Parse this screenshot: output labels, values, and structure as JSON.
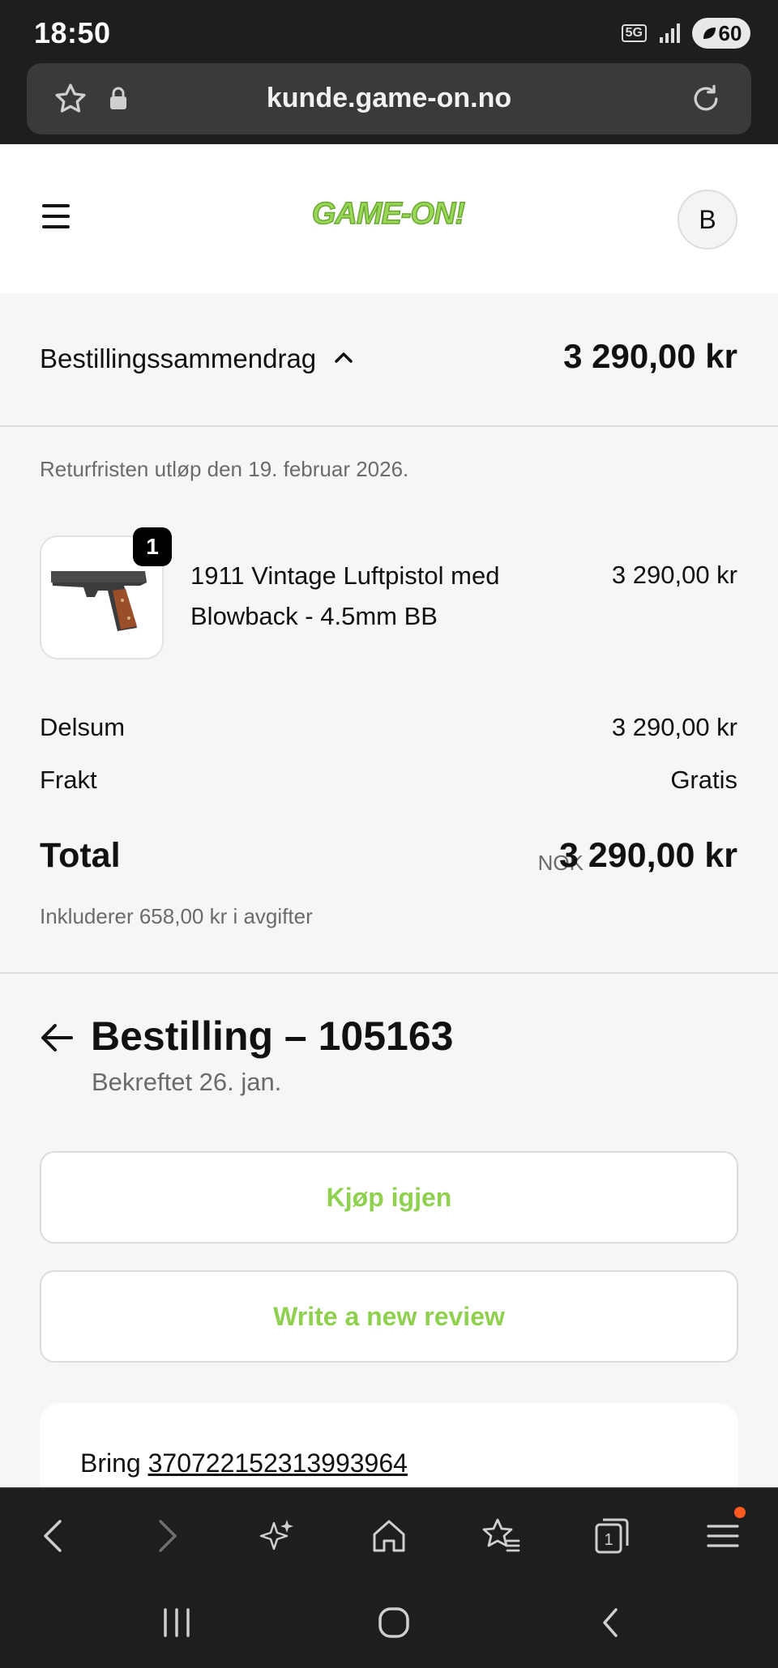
{
  "status_bar": {
    "time": "18:50",
    "network": "5G",
    "battery": "60"
  },
  "browser": {
    "url": "kunde.game-on.no"
  },
  "header": {
    "logo_text": "GAME-ON!",
    "avatar_initial": "B"
  },
  "summary": {
    "label": "Bestillingssammendrag",
    "total": "3 290,00 kr",
    "return_note": "Returfristen utløp den 19. februar 2026.",
    "item": {
      "quantity": "1",
      "title": "1911 Vintage Luftpistol med Blowback - 4.5mm BB",
      "price": "3 290,00 kr"
    },
    "subtotal_label": "Delsum",
    "subtotal_value": "3 290,00 kr",
    "shipping_label": "Frakt",
    "shipping_value": "Gratis",
    "total_label": "Total",
    "total_currency": "NOK",
    "total_value": "3 290,00 kr",
    "tax_note": "Inkluderer 658,00 kr i avgifter"
  },
  "order": {
    "title": "Bestilling – 105163",
    "subtitle": "Bekreftet 26. jan.",
    "buy_again_label": "Kjøp igjen",
    "review_label": "Write a new review",
    "carrier": "Bring",
    "tracking_number": "370722152313993964"
  },
  "colors": {
    "accent": "#8fd14f",
    "dark_chrome": "#1e1e20",
    "notification": "#ff5a1f"
  },
  "icons": {
    "url_left": [
      "star-icon",
      "lock-icon"
    ],
    "url_right": "reload-icon",
    "toolbar": [
      "back-icon",
      "forward-icon",
      "sparkle-icon",
      "home-icon",
      "bookmarks-icon",
      "tabs-icon",
      "menu-icon"
    ],
    "tabs_count": "1",
    "system_nav": [
      "recents-icon",
      "home-circle-icon",
      "system-back-icon"
    ]
  }
}
